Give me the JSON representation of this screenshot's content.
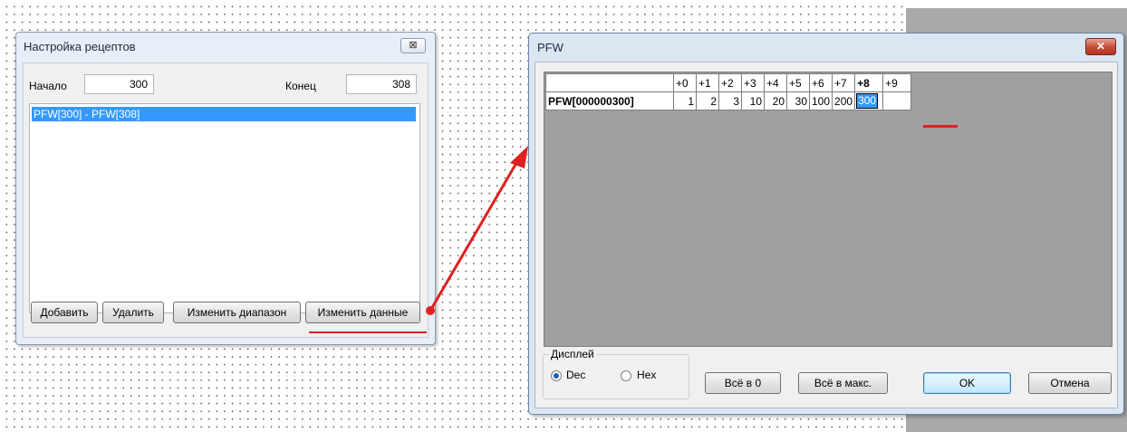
{
  "recipe_dialog": {
    "title": "Настройка рецептов",
    "close_label": "⊠",
    "start_label": "Начало",
    "start_value": "300",
    "end_label": "Конец",
    "end_value": "308",
    "list_items": [
      "PFW[300] - PFW[308]"
    ],
    "buttons": {
      "add": "Добавить",
      "delete": "Удалить",
      "change_range": "Изменить диапазон",
      "change_data": "Изменить данные"
    }
  },
  "pfw_dialog": {
    "title": "PFW",
    "close_label": "✕",
    "columns": [
      "+0",
      "+1",
      "+2",
      "+3",
      "+4",
      "+5",
      "+6",
      "+7",
      "+8",
      "+9"
    ],
    "row_label": "PFW[000000300]",
    "values": [
      "1",
      "2",
      "3",
      "10",
      "20",
      "30",
      "100",
      "200",
      "300",
      ""
    ],
    "display_group_label": "Дисплей",
    "radio_dec": "Dec",
    "radio_hex": "Hex",
    "selected_format": "Dec",
    "buttons": {
      "all_zero": "Всё в 0",
      "all_max": "Всё в макс.",
      "ok": "OK",
      "cancel": "Отмена"
    }
  },
  "annotation_color": "#e02020"
}
